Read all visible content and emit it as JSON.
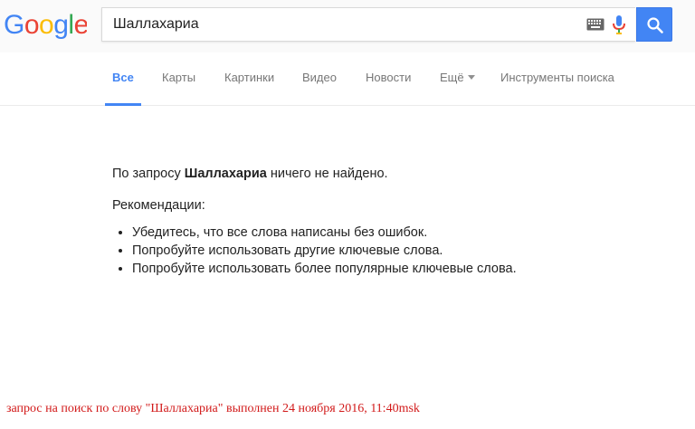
{
  "logo": {
    "text": "Google"
  },
  "search": {
    "value": "Шаллахариа",
    "keyboard_icon": "keyboard-icon",
    "mic_icon": "microphone-icon",
    "button_icon": "search-icon"
  },
  "tabs": [
    {
      "label": "Все",
      "active": true
    },
    {
      "label": "Карты",
      "active": false
    },
    {
      "label": "Картинки",
      "active": false
    },
    {
      "label": "Видео",
      "active": false
    },
    {
      "label": "Новости",
      "active": false
    },
    {
      "label": "Ещё",
      "active": false
    },
    {
      "label": "Инструменты поиска",
      "active": false
    }
  ],
  "results": {
    "no_results_prefix": "По запросу ",
    "query": "Шаллахариа",
    "no_results_suffix": " ничего не найдено.",
    "recommendations_title": "Рекомендации:",
    "recommendations": [
      "Убедитесь, что все слова написаны без ошибок.",
      "Попробуйте использовать другие ключевые слова.",
      "Попробуйте использовать более популярные ключевые слова."
    ]
  },
  "caption": "запрос на поиск по слову \"Шаллахариа\" выполнен 24 ноября 2016, 11:40msk",
  "colors": {
    "accent": "#4285f4",
    "caption": "#d21a1a",
    "tab_text": "#777777"
  }
}
